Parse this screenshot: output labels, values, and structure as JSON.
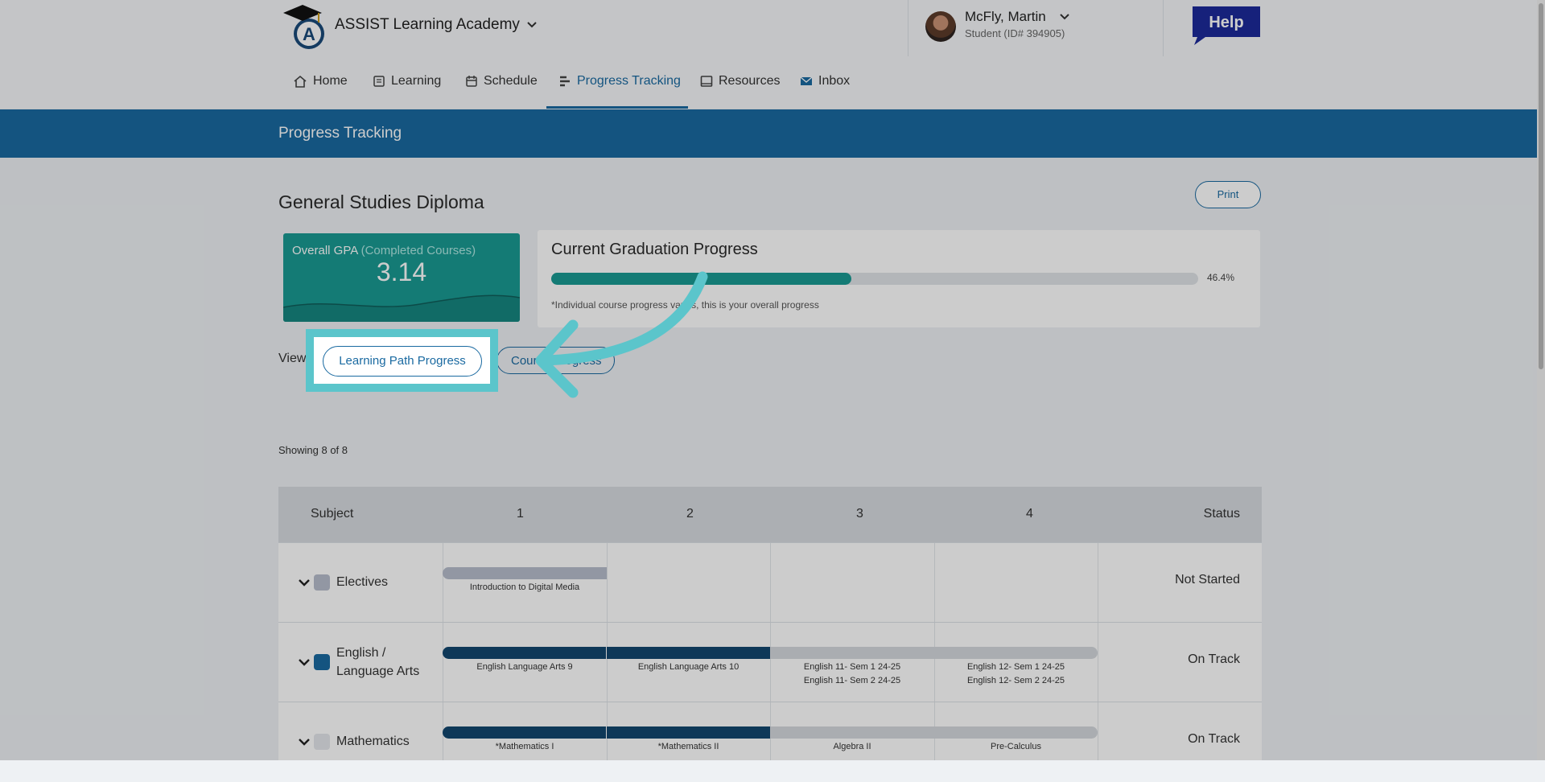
{
  "header": {
    "academy_name": "ASSIST Learning Academy",
    "user_name": "McFly, Martin",
    "user_id": "Student (ID# 394905)",
    "help_label": "Help"
  },
  "nav": {
    "items": [
      {
        "label": "Home",
        "icon": "home-icon"
      },
      {
        "label": "Learning",
        "icon": "book-icon"
      },
      {
        "label": "Schedule",
        "icon": "calendar-icon"
      },
      {
        "label": "Progress Tracking",
        "icon": "progress-icon",
        "active": true
      },
      {
        "label": "Resources",
        "icon": "resources-icon"
      },
      {
        "label": "Inbox",
        "icon": "mail-icon"
      }
    ]
  },
  "banner": {
    "title": "Progress Tracking"
  },
  "main": {
    "diploma_title": "General Studies Diploma",
    "print_label": "Print",
    "gpa": {
      "label": "Overall GPA",
      "sub_label": "(Completed Courses)",
      "value": "3.14"
    },
    "graduation": {
      "title": "Current Graduation Progress",
      "progress": 46.4,
      "percent_label": "46.4%",
      "note": "*Individual course progress varies, this is your overall progress"
    },
    "view_label": "View",
    "view_buttons": {
      "learning_path": "Learning Path Progress",
      "course": "Course Progress"
    },
    "showing": "Showing 8 of 8"
  },
  "table": {
    "headers": [
      "Subject",
      "1",
      "2",
      "3",
      "4",
      "Status"
    ],
    "rows": [
      {
        "subject": "Electives",
        "swatch_color": "#b7bdcc",
        "status": "Not Started",
        "segments": [
          {
            "col": 1,
            "span": 1,
            "color": "#b7bdcc",
            "labels": [
              "Introduction to Digital Media"
            ]
          }
        ]
      },
      {
        "subject_lines": [
          "English /",
          "Language Arts"
        ],
        "swatch_color": "#1a6aa1",
        "status": "On Track",
        "segments": [
          {
            "col": 1,
            "span": 1,
            "color": "#12466f",
            "labels": [
              "English Language Arts 9"
            ]
          },
          {
            "col": 2,
            "span": 1,
            "color": "#12466f",
            "labels": [
              "English Language Arts 10"
            ]
          },
          {
            "col": 3,
            "span": 1,
            "color": "#d5d9de",
            "labels": [
              "English 11- Sem 1 24-25",
              "English 11- Sem 2 24-25"
            ]
          },
          {
            "col": 4,
            "span": 1,
            "color": "#d5d9de",
            "labels": [
              "English 12- Sem 1 24-25",
              "English 12- Sem 2 24-25"
            ]
          }
        ]
      },
      {
        "subject": "Mathematics",
        "swatch_color": "#e4e7eb",
        "status": "On Track",
        "segments": [
          {
            "col": 1,
            "span": 1,
            "color": "#12466f",
            "labels": [
              "*Mathematics I"
            ]
          },
          {
            "col": 2,
            "span": 1,
            "color": "#12466f",
            "labels": [
              "*Mathematics II"
            ]
          },
          {
            "col": 3,
            "span": 1,
            "color": "#d5d9de",
            "labels": [
              "Algebra II"
            ]
          },
          {
            "col": 4,
            "span": 1,
            "color": "#d5d9de",
            "labels": [
              "Pre-Calculus"
            ]
          }
        ]
      }
    ]
  },
  "colors": {
    "brand_blue": "#1a6aa1",
    "teal": "#1a9a93",
    "highlight": "#5bc5cb"
  }
}
